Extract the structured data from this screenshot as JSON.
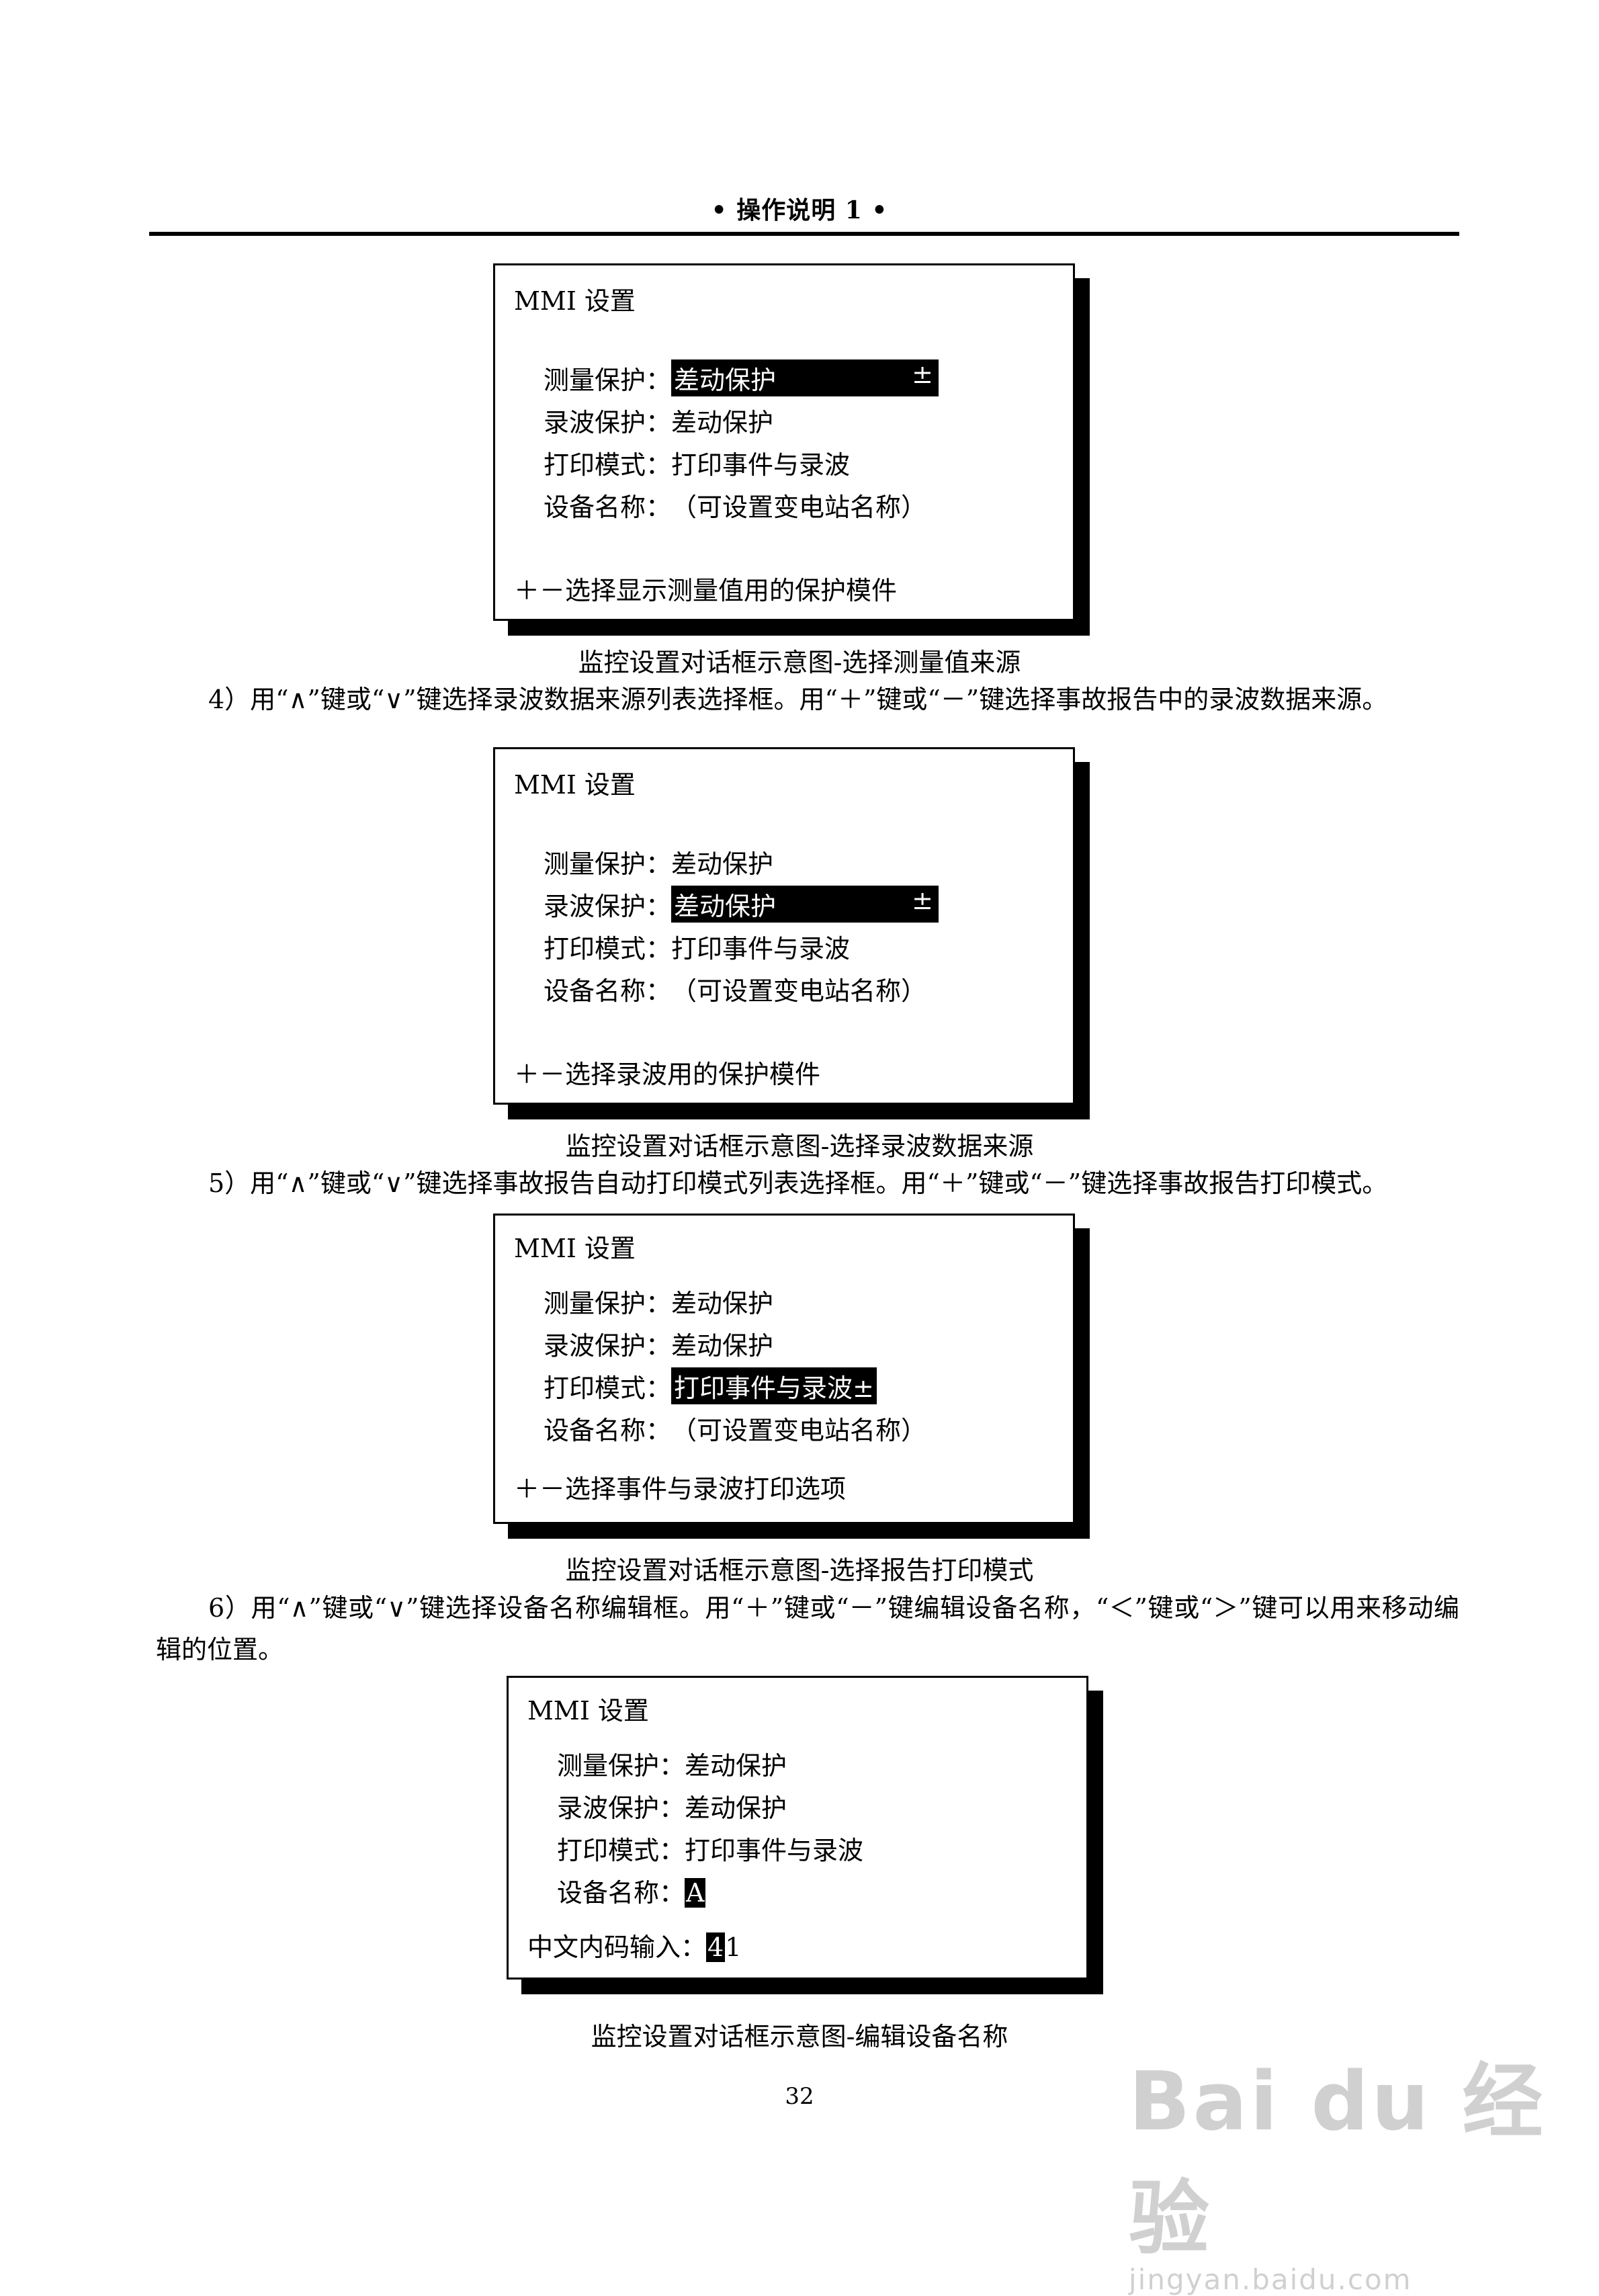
{
  "header": "• 操作说明 1 •",
  "dialogs": [
    {
      "title": "MMI 设置",
      "fields": [
        {
          "label": "测量保护：",
          "value": "差动保护",
          "suffix": "±"
        },
        {
          "label": "录波保护：",
          "value": "差动保护"
        },
        {
          "label": "打印模式：",
          "value": "打印事件与录波"
        },
        {
          "label": "设备名称：",
          "value": "（可设置变电站名称）"
        }
      ],
      "hint": "＋－选择显示测量值用的保护模件",
      "caption": "监控设置对话框示意图-选择测量值来源"
    },
    {
      "title": "MMI 设置",
      "fields": [
        {
          "label": "测量保护：",
          "value": "差动保护"
        },
        {
          "label": "录波保护：",
          "value": "差动保护",
          "suffix": "±"
        },
        {
          "label": "打印模式：",
          "value": "打印事件与录波"
        },
        {
          "label": "设备名称：",
          "value": "（可设置变电站名称）"
        }
      ],
      "hint": "＋－选择录波用的保护模件",
      "caption": "监控设置对话框示意图-选择录波数据来源"
    },
    {
      "title": "MMI 设置",
      "fields": [
        {
          "label": "测量保护：",
          "value": "差动保护"
        },
        {
          "label": "录波保护：",
          "value": "差动保护"
        },
        {
          "label": "打印模式：",
          "value": "打印事件与录波±"
        },
        {
          "label": "设备名称：",
          "value": "（可设置变电站名称）"
        }
      ],
      "hint": "＋－选择事件与录波打印选项",
      "caption": "监控设置对话框示意图-选择报告打印模式"
    },
    {
      "title": "MMI 设置",
      "fields": [
        {
          "label": "测量保护：",
          "value": "差动保护"
        },
        {
          "label": "录波保护：",
          "value": "差动保护"
        },
        {
          "label": "打印模式：",
          "value": "打印事件与录波"
        },
        {
          "label": "设备名称：",
          "value": "A"
        }
      ],
      "input_label": "中文内码输入：",
      "input_cursor": "4",
      "input_rest": "1",
      "caption": "监控设置对话框示意图-编辑设备名称"
    }
  ],
  "paragraphs": {
    "p4": "4）用“∧”键或“∨”键选择录波数据来源列表选择框。用“＋”键或“－”键选择事故报告中的录波数据来源。",
    "p5": "5）用“∧”键或“∨”键选择事故报告自动打印模式列表选择框。用“＋”键或“－”键选择事故报告打印模式。",
    "p6": "6）用“∧”键或“∨”键选择设备名称编辑框。用“＋”键或“－”键编辑设备名称，“＜”键或“＞”键可以用来移动编辑的位置。"
  },
  "page_number": "32",
  "watermark": {
    "brand": "Bai du 经验",
    "url": "jingyan.baidu.com"
  }
}
